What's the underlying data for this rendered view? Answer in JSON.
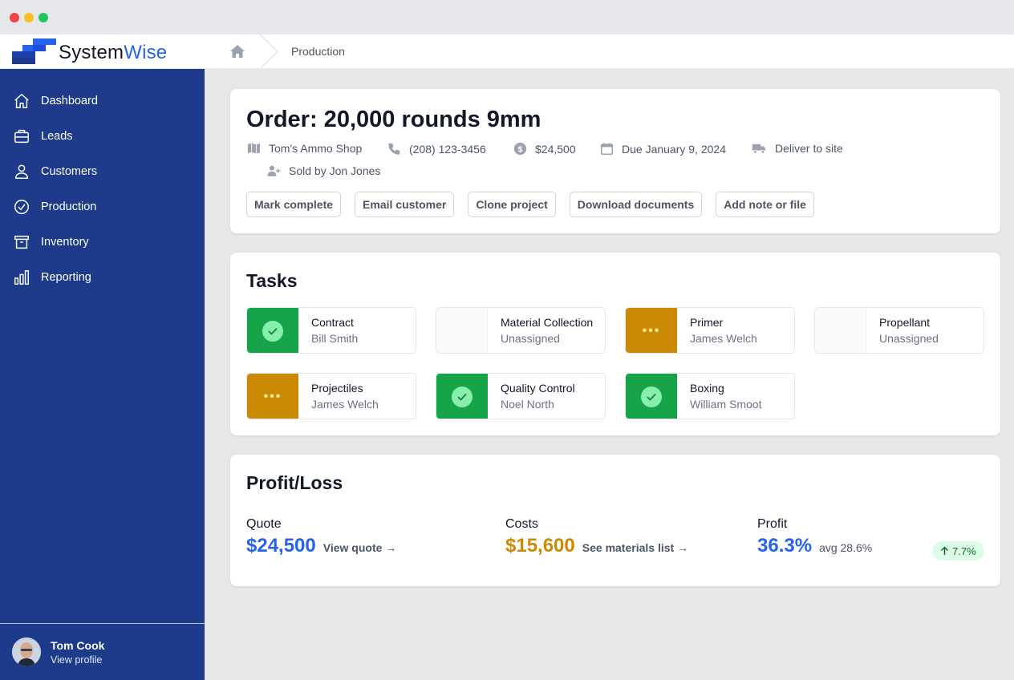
{
  "app": {
    "brand_prefix": "System",
    "brand_accent": "Wise",
    "colors": {
      "sidebar": "#1e3a8a",
      "accent": "#2563eb",
      "done": "#16a34a",
      "in_progress": "#ca8a04",
      "costs": "#ca8a04"
    }
  },
  "breadcrumb": {
    "home_icon": "home-icon",
    "current": "Production"
  },
  "sidebar": {
    "items": [
      {
        "label": "Dashboard",
        "icon": "home-icon"
      },
      {
        "label": "Leads",
        "icon": "briefcase-icon"
      },
      {
        "label": "Customers",
        "icon": "user-icon"
      },
      {
        "label": "Production",
        "icon": "check-circle-icon"
      },
      {
        "label": "Inventory",
        "icon": "archive-icon"
      },
      {
        "label": "Reporting",
        "icon": "bar-chart-icon"
      }
    ],
    "profile": {
      "name": "Tom Cook",
      "link": "View profile"
    }
  },
  "order": {
    "title": "Order: 20,000 rounds 9mm",
    "customer": "Tom's Ammo Shop",
    "phone": "(208) 123-3456",
    "amount": "$24,500",
    "due": "Due January 9, 2024",
    "delivery": "Deliver to site",
    "sold_by": "Sold by Jon Jones",
    "actions": [
      "Mark complete",
      "Email customer",
      "Clone project",
      "Download documents",
      "Add note or file"
    ]
  },
  "tasks": {
    "title": "Tasks",
    "items": [
      {
        "name": "Contract",
        "assignee": "Bill Smith",
        "status": "done"
      },
      {
        "name": "Material Collection",
        "assignee": "Unassigned",
        "status": "none"
      },
      {
        "name": "Primer",
        "assignee": "James Welch",
        "status": "progress"
      },
      {
        "name": "Propellant",
        "assignee": "Unassigned",
        "status": "none"
      },
      {
        "name": "Projectiles",
        "assignee": "James Welch",
        "status": "progress"
      },
      {
        "name": "Quality Control",
        "assignee": "Noel North",
        "status": "done"
      },
      {
        "name": "Boxing",
        "assignee": "William Smoot",
        "status": "done"
      }
    ]
  },
  "profit_loss": {
    "title": "Profit/Loss",
    "quote": {
      "label": "Quote",
      "value": "$24,500",
      "link": "View quote →"
    },
    "costs": {
      "label": "Costs",
      "value": "$15,600",
      "link": "See materials list →"
    },
    "profit": {
      "label": "Profit",
      "value": "36.3%",
      "avg": "avg 28.6%",
      "change": "7.7%"
    }
  }
}
